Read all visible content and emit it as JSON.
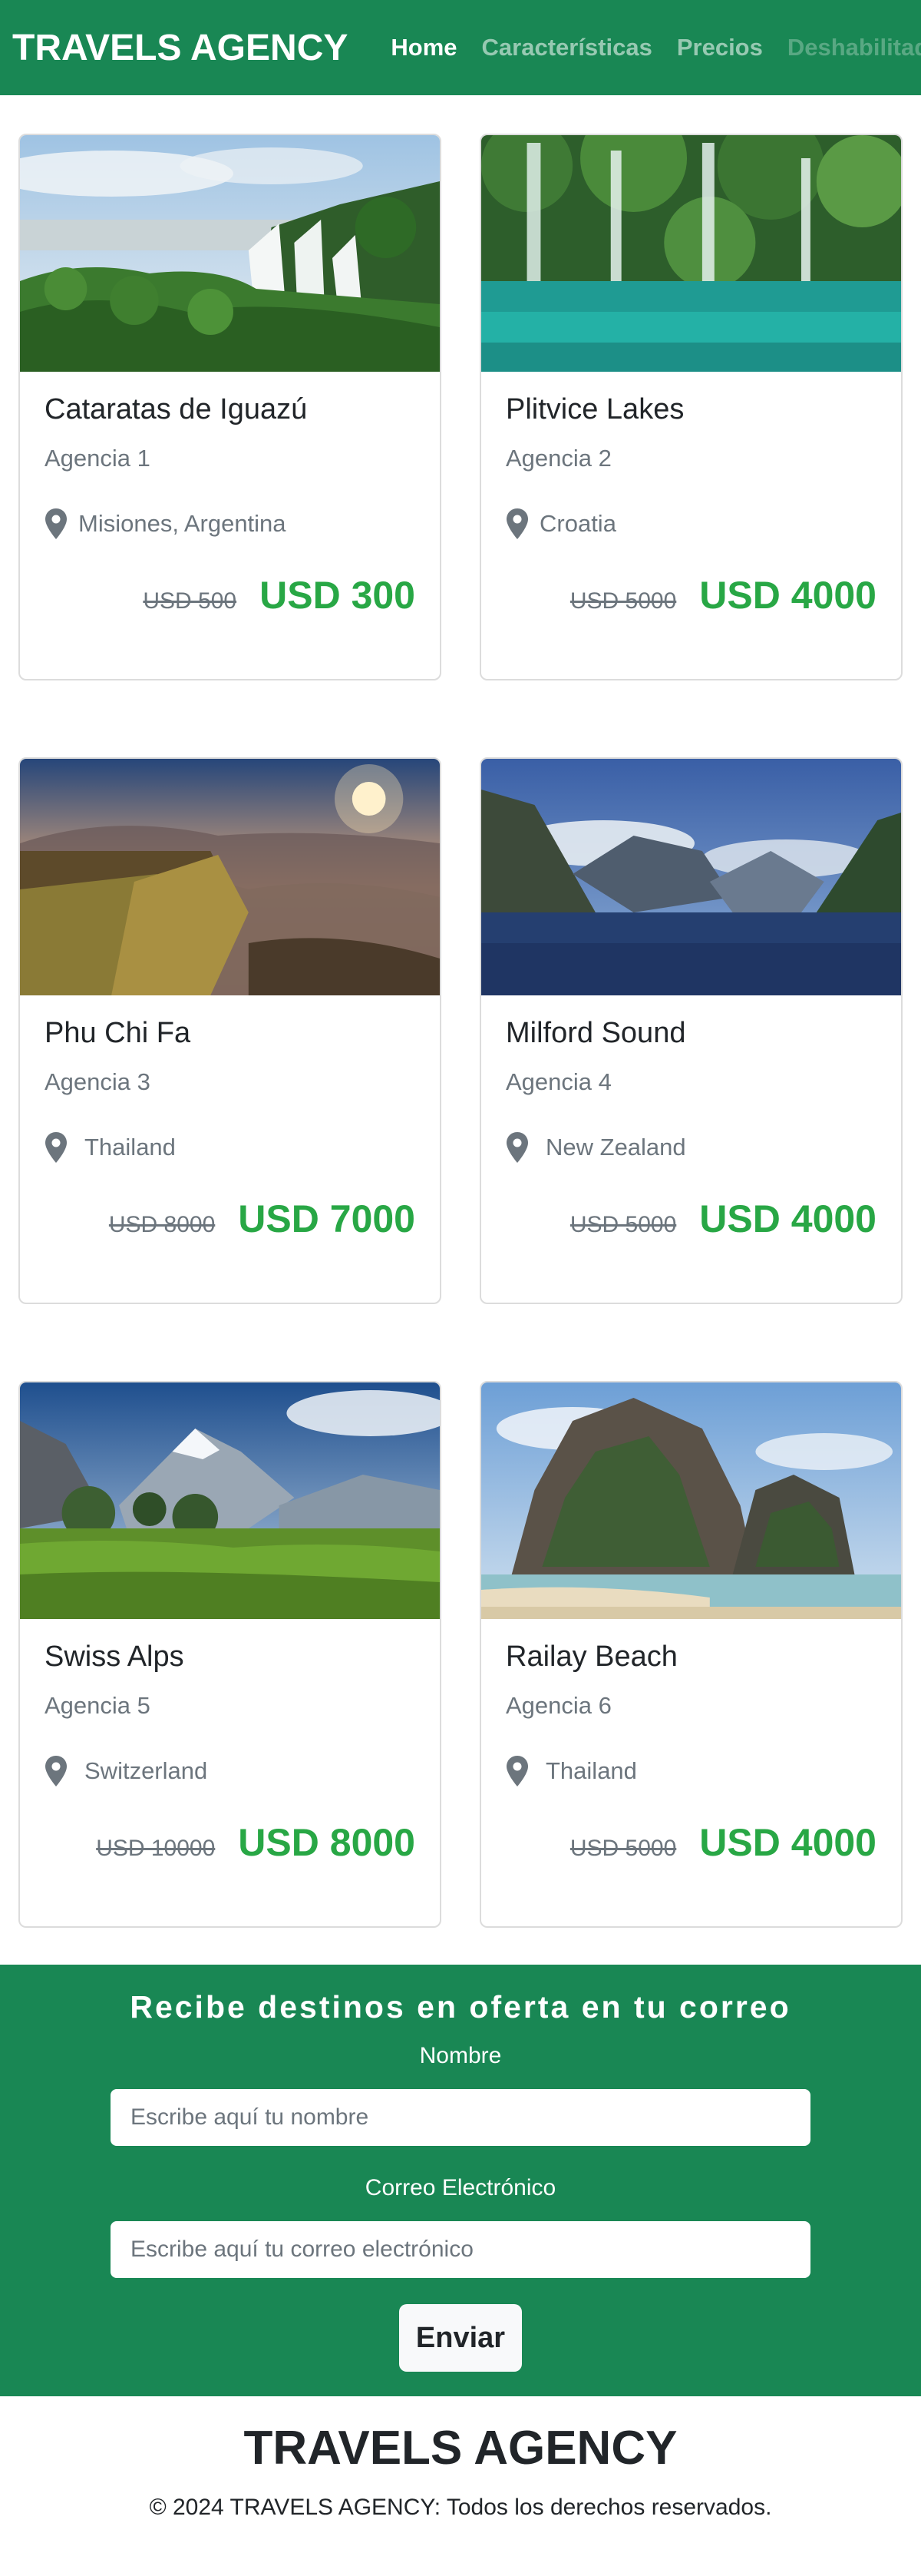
{
  "navbar": {
    "brand": "TRAVELS AGENCY",
    "links": [
      {
        "label": "Home",
        "state": "active"
      },
      {
        "label": "Características",
        "state": "normal"
      },
      {
        "label": "Precios",
        "state": "normal"
      },
      {
        "label": "Deshabilitado",
        "state": "disabled"
      }
    ]
  },
  "cards": [
    {
      "title": "Cataratas de Iguazú",
      "agency": "Agencia 1",
      "location": "Misiones, Argentina",
      "old_price": "USD 500",
      "new_price": "USD 300",
      "image": "waterfalls-jungle-photo"
    },
    {
      "title": "Plitvice Lakes",
      "agency": "Agencia 2",
      "location": "Croatia",
      "old_price": "USD 5000",
      "new_price": "USD 4000",
      "image": "turquoise-lake-waterfalls-photo"
    },
    {
      "title": "Phu Chi Fa",
      "agency": "Agencia 3",
      "location": "Thailand",
      "old_price": "USD 8000",
      "new_price": "USD 7000",
      "image": "mountain-sunrise-photo"
    },
    {
      "title": "Milford Sound",
      "agency": "Agencia 4",
      "location": "New Zealand",
      "old_price": "USD 5000",
      "new_price": "USD 4000",
      "image": "fjord-mountains-photo"
    },
    {
      "title": "Swiss Alps",
      "agency": "Agencia 5",
      "location": "Switzerland",
      "old_price": "USD 10000",
      "new_price": "USD 8000",
      "image": "alpine-meadow-photo"
    },
    {
      "title": "Railay Beach",
      "agency": "Agencia 6",
      "location": "Thailand",
      "old_price": "USD 5000",
      "new_price": "USD 4000",
      "image": "limestone-beach-photo"
    }
  ],
  "newsletter": {
    "title": "Recibe destinos en oferta en tu correo",
    "name_label": "Nombre",
    "name_placeholder": "Escribe aquí tu nombre",
    "email_label": "Correo Electrónico",
    "email_placeholder": "Escribe aquí tu correo electrónico",
    "submit_label": "Enviar"
  },
  "footer": {
    "brand": "TRAVELS AGENCY",
    "copyright": "© 2024 TRAVELS AGENCY: Todos los derechos reservados."
  },
  "colors": {
    "primary_green": "#198754",
    "price_green": "#28a745",
    "muted_text": "#6c757d"
  }
}
